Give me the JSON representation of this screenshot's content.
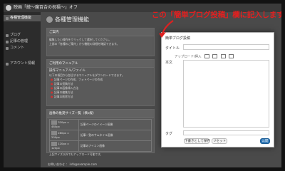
{
  "admin_bar": {
    "site_name": "映画「続～魔百合の祝福～」オフ",
    "right_text": ""
  },
  "sidebar": {
    "items": [
      {
        "label": "各種管理機能",
        "active": true
      },
      {
        "label": "ブログ",
        "active": false
      },
      {
        "label": "記事の管理",
        "active": false
      },
      {
        "label": "コメント",
        "active": false
      },
      {
        "label": "アカウント情報",
        "active": false
      }
    ]
  },
  "main": {
    "title": "各種管理機能",
    "panel1": {
      "heading": "ご案内",
      "lines": [
        "編集したい操作をクリックして選択してください。",
        "上部の「各種のご案内」から機能の詳細を確認できます。"
      ]
    },
    "panel2": {
      "heading": "ご利用のマニュアル",
      "subheading": "操作マニュアル/ファイル",
      "intro": "以下の項目から該当するマニュアルをダウンロードできます。",
      "items": [
        "記事ページの作成、フォトページの作成",
        "記事の投稿方法",
        "記事の画像挿入方法",
        "記事の編集方法",
        "記事の削除方法"
      ]
    },
    "panel3": {
      "heading": "画像の推奨サイズ一覧（横x縦）",
      "rows": [
        {
          "size": "320px x 480px",
          "desc": "記事ページのイメージ画像"
        },
        {
          "size": "280px x 200px",
          "desc": "記事一覧のサムネイル画像"
        },
        {
          "size": "120px x 120px",
          "desc": "記事のアイコン画像"
        }
      ],
      "note": "上記サイズ以外でもアップロード可能です。"
    },
    "footer": "お問い合わせ ： info@example.com"
  },
  "modal": {
    "title": "簡単ブログ投稿",
    "title_label": "タイトル",
    "upload_label": "アップロード/挿入",
    "body_label": "本文",
    "tag_label": "タグ",
    "buttons": {
      "draft": "下書きとして保存",
      "reset": "リセット",
      "publish": "公開"
    }
  },
  "annotation": {
    "text": "この「簡単ブログ投稿」欄に記入します。",
    "color": "#e02020"
  }
}
